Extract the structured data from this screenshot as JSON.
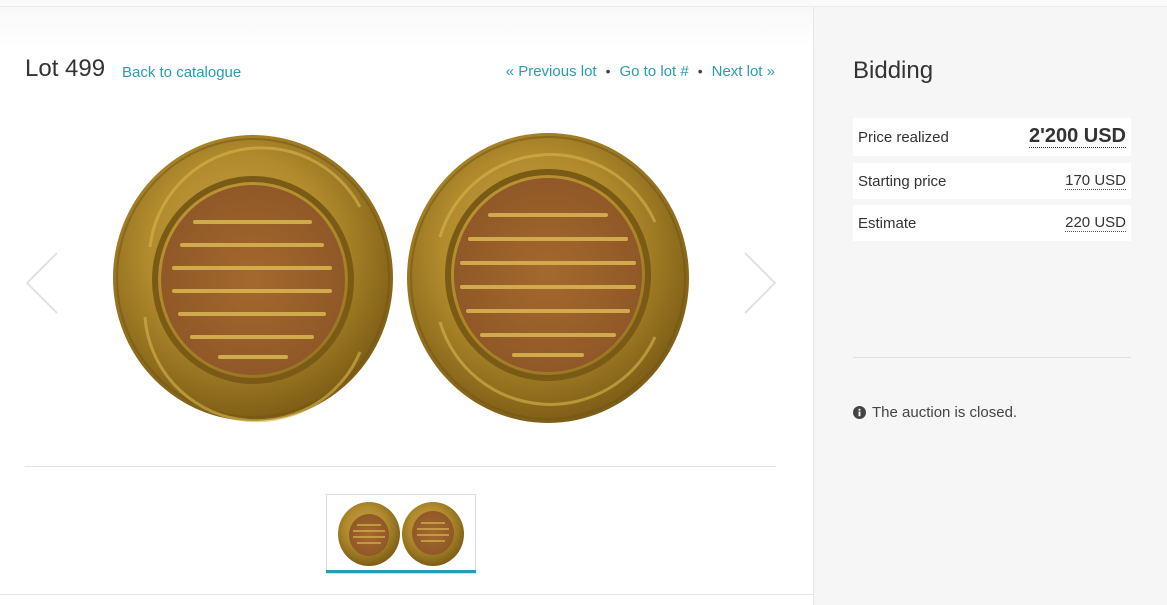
{
  "header": {
    "lot_title": "Lot 499",
    "back_link": "Back to catalogue",
    "prev_lot": "« Previous lot",
    "go_to_lot": "Go to lot #",
    "next_lot": "Next lot »",
    "separator": "•"
  },
  "gallery": {
    "left_arrow_icon": "chevron-left-icon",
    "right_arrow_icon": "chevron-right-icon",
    "image": "gold coin obverse and reverse with Arabic inscriptions",
    "thumbnail_count": 1,
    "active_thumbnail": 1
  },
  "bidding": {
    "title": "Bidding",
    "rows": [
      {
        "label": "Price realized",
        "value": "2'200 USD"
      },
      {
        "label": "Starting price",
        "value": "170 USD"
      },
      {
        "label": "Estimate",
        "value": "220 USD"
      }
    ],
    "status_icon": "info-circle-icon",
    "status_text": "The auction is closed."
  },
  "colors": {
    "link": "#2a9cb0",
    "sidebar_bg": "#f6f6f6",
    "active_thumb_bar": "#2a9cb0"
  }
}
